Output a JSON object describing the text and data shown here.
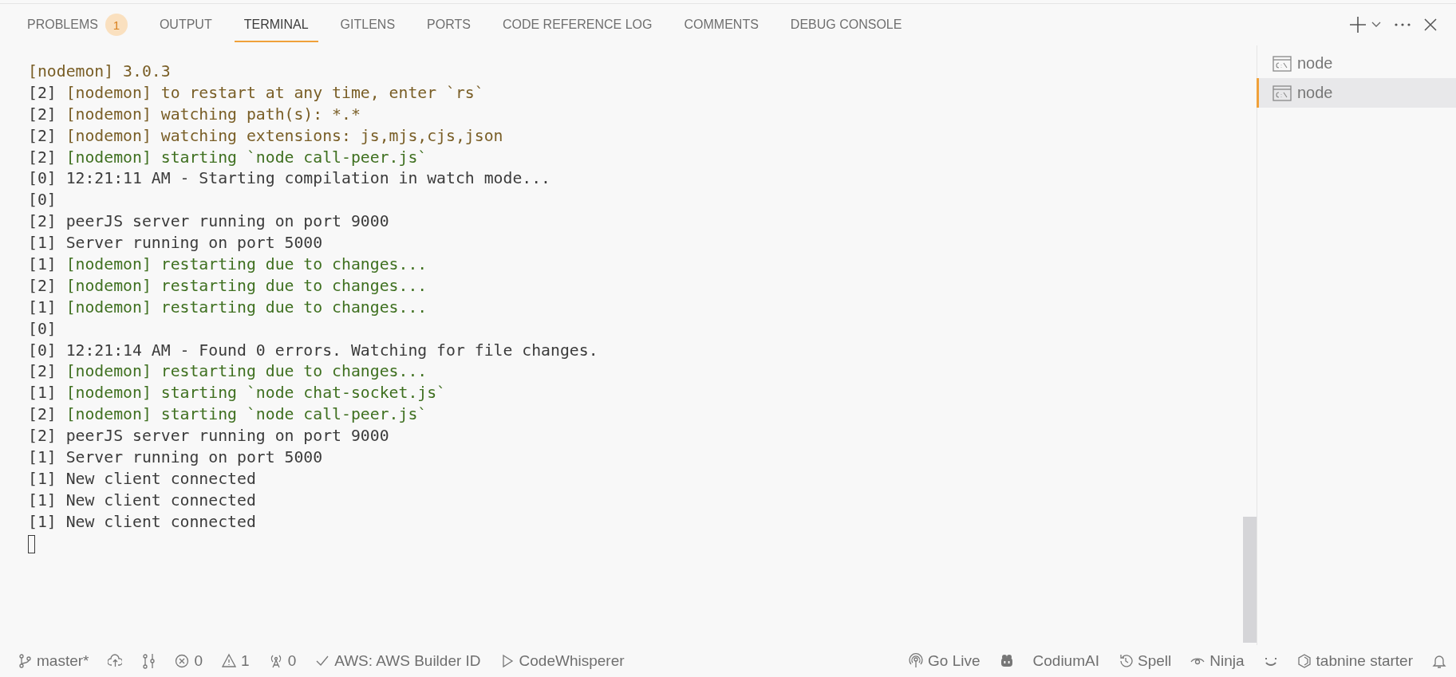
{
  "tabs": [
    {
      "label": "PROBLEMS",
      "badge": "1",
      "selected": false
    },
    {
      "label": "OUTPUT",
      "selected": false
    },
    {
      "label": "TERMINAL",
      "selected": true
    },
    {
      "label": "GITLENS",
      "selected": false
    },
    {
      "label": "PORTS",
      "selected": false
    },
    {
      "label": "CODE REFERENCE LOG",
      "selected": false
    },
    {
      "label": "COMMENTS",
      "selected": false
    },
    {
      "label": "DEBUG CONSOLE",
      "selected": false
    }
  ],
  "terminal": {
    "lines": [
      {
        "text": "[nodemon] 3.0.3",
        "kind": "warn"
      },
      {
        "prefix": "[2]",
        "text": "[nodemon] to restart at any time, enter `rs`",
        "kind": "warn"
      },
      {
        "prefix": "[2]",
        "text": "[nodemon] watching path(s): *.*",
        "kind": "warn"
      },
      {
        "prefix": "[2]",
        "text": "[nodemon] watching extensions: js,mjs,cjs,json",
        "kind": "warn"
      },
      {
        "prefix": "[2]",
        "text": "[nodemon] starting `node call-peer.js`",
        "kind": "ok"
      },
      {
        "prefix": "[0]",
        "text": "12:21:11 AM - Starting compilation in watch mode...",
        "kind": "plain"
      },
      {
        "prefix": "[0]",
        "kind": "plain"
      },
      {
        "prefix": "[2]",
        "text": "peerJS server running on port 9000",
        "kind": "plain"
      },
      {
        "prefix": "[1]",
        "text": "Server running on port 5000",
        "kind": "plain"
      },
      {
        "prefix": "[1]",
        "text": "[nodemon] restarting due to changes...",
        "kind": "ok"
      },
      {
        "prefix": "[2]",
        "text": "[nodemon] restarting due to changes...",
        "kind": "ok"
      },
      {
        "prefix": "[1]",
        "text": "[nodemon] restarting due to changes...",
        "kind": "ok"
      },
      {
        "prefix": "[0]",
        "kind": "plain"
      },
      {
        "prefix": "[0]",
        "text": "12:21:14 AM - Found 0 errors. Watching for file changes.",
        "kind": "plain"
      },
      {
        "prefix": "[2]",
        "text": "[nodemon] restarting due to changes...",
        "kind": "ok"
      },
      {
        "prefix": "[1]",
        "text": "[nodemon] starting `node chat-socket.js`",
        "kind": "ok"
      },
      {
        "prefix": "[2]",
        "text": "[nodemon] starting `node call-peer.js`",
        "kind": "ok"
      },
      {
        "prefix": "[2]",
        "text": "peerJS server running on port 9000",
        "kind": "plain"
      },
      {
        "prefix": "[1]",
        "text": "Server running on port 5000",
        "kind": "plain"
      },
      {
        "prefix": "[1]",
        "text": "New client connected",
        "kind": "plain"
      },
      {
        "prefix": "[1]",
        "text": "New client connected",
        "kind": "plain"
      },
      {
        "prefix": "[1]",
        "text": "New client connected",
        "kind": "plain"
      }
    ],
    "sessions": [
      {
        "label": "node",
        "selected": false
      },
      {
        "label": "node",
        "selected": true
      }
    ]
  },
  "status_bar": {
    "left": [
      {
        "kind": "branch",
        "text": "master*"
      },
      {
        "kind": "cloud"
      },
      {
        "kind": "graph"
      },
      {
        "kind": "error",
        "text": "0"
      },
      {
        "kind": "warning",
        "text": "1"
      },
      {
        "kind": "antenna",
        "text": "0"
      },
      {
        "kind": "check",
        "text": "AWS: AWS Builder ID"
      },
      {
        "kind": "play",
        "text": "CodeWhisperer"
      }
    ],
    "right": [
      {
        "kind": "broadcast",
        "text": "Go Live"
      },
      {
        "kind": "bot"
      },
      {
        "kind": "none",
        "text": "CodiumAI"
      },
      {
        "kind": "history",
        "text": "Spell"
      },
      {
        "kind": "eye",
        "text": "Ninja"
      },
      {
        "kind": "smile"
      },
      {
        "kind": "hexagon",
        "text": "tabnine starter"
      },
      {
        "kind": "bell"
      }
    ]
  }
}
